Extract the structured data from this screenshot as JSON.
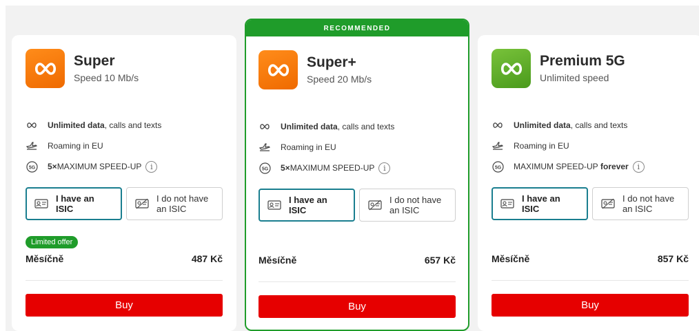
{
  "colors": {
    "brand_red": "#e60000",
    "recommended_green": "#1f9c2a",
    "selected_teal": "#197e8f"
  },
  "plans": [
    {
      "name": "Super",
      "subtitle": "Speed 10 Mb/s",
      "logo_color": "orange",
      "logo_icon": "infinity-icon",
      "recommended": "",
      "features": [
        {
          "icon": "infinity-icon",
          "bold": "Unlimited data",
          "text": ", calls and texts",
          "bold_after": ""
        },
        {
          "icon": "plane-icon",
          "bold": "",
          "text": "Roaming in EU",
          "bold_after": ""
        },
        {
          "icon": "5g-icon",
          "bold": "5×",
          "text": " MAXIMUM SPEED-UP",
          "bold_after": ""
        }
      ],
      "isic_yes": "I have an ISIC",
      "isic_no": "I do not have an ISIC",
      "badge": "Limited offer",
      "price_label": "Měsíčně",
      "price": "487 Kč",
      "buy_label": "Buy"
    },
    {
      "name": "Super+",
      "subtitle": "Speed 20 Mb/s",
      "logo_color": "orange",
      "logo_icon": "infinity-icon",
      "recommended": "RECOMMENDED",
      "features": [
        {
          "icon": "infinity-icon",
          "bold": "Unlimited data",
          "text": ", calls and texts",
          "bold_after": ""
        },
        {
          "icon": "plane-icon",
          "bold": "",
          "text": "Roaming in EU",
          "bold_after": ""
        },
        {
          "icon": "5g-icon",
          "bold": "5×",
          "text": " MAXIMUM SPEED-UP",
          "bold_after": ""
        }
      ],
      "isic_yes": "I have an ISIC",
      "isic_no": "I do not have an ISIC",
      "badge": "",
      "price_label": "Měsíčně",
      "price": "657 Kč",
      "buy_label": "Buy"
    },
    {
      "name": "Premium 5G",
      "subtitle": "Unlimited speed",
      "logo_color": "green",
      "logo_icon": "infinity-icon",
      "recommended": "",
      "features": [
        {
          "icon": "infinity-icon",
          "bold": "Unlimited data",
          "text": ", calls and texts",
          "bold_after": ""
        },
        {
          "icon": "plane-icon",
          "bold": "",
          "text": "Roaming in EU",
          "bold_after": ""
        },
        {
          "icon": "5g-icon",
          "bold": "",
          "text": "MAXIMUM SPEED-UP ",
          "bold_after": "forever"
        }
      ],
      "isic_yes": "I have an ISIC",
      "isic_no": "I do not have an ISIC",
      "badge": "",
      "price_label": "Měsíčně",
      "price": "857 Kč",
      "buy_label": "Buy"
    }
  ]
}
